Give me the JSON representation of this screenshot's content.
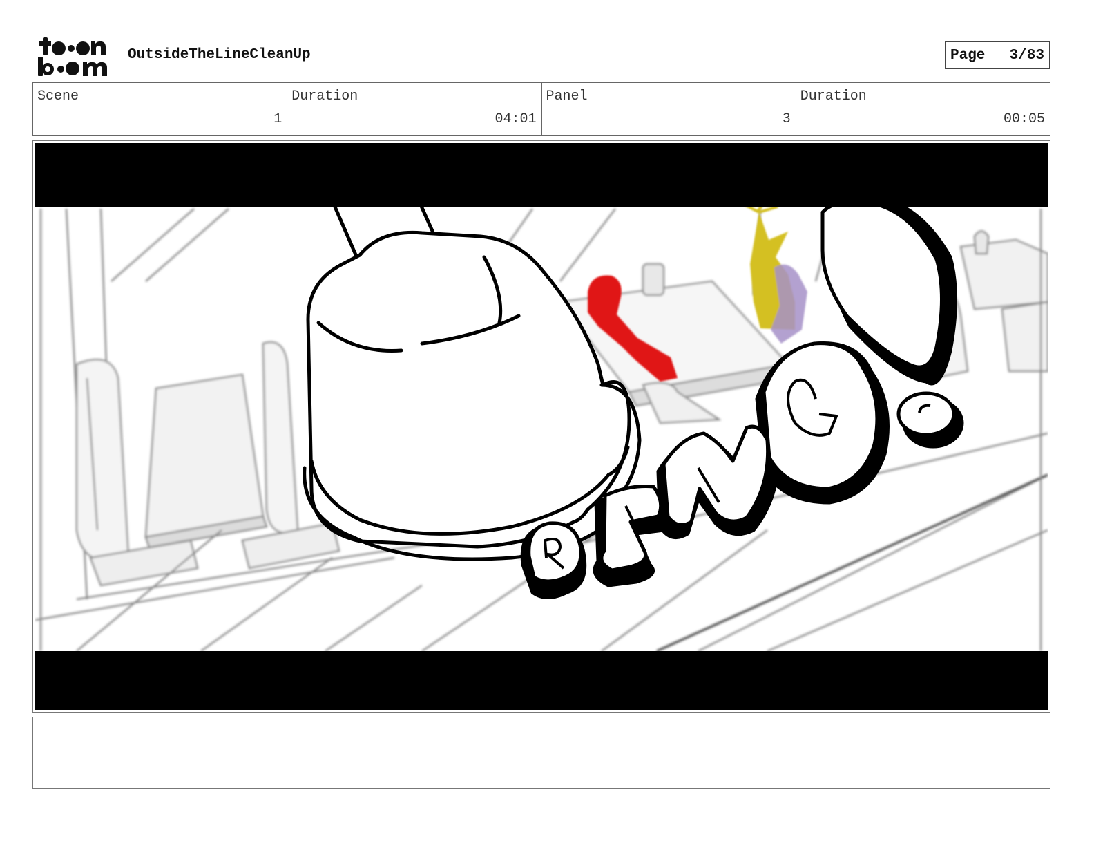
{
  "header": {
    "logo_text": "toonboom",
    "project_title": "OutsideTheLineCleanUp",
    "page_label": "Page",
    "page_value": "3/83"
  },
  "info": {
    "scene_label": "Scene",
    "scene_value": "1",
    "scene_duration_label": "Duration",
    "scene_duration_value": "04:01",
    "panel_label": "Panel",
    "panel_value": "3",
    "panel_duration_label": "Duration",
    "panel_duration_value": "00:05"
  },
  "panel": {
    "sfx_text": "RING!",
    "colors": {
      "letterbox": "#000000",
      "figure_red": "#e01818",
      "figure_gold": "#d4c020",
      "figure_purple": "#a690c8"
    }
  },
  "notes": {
    "text": ""
  }
}
